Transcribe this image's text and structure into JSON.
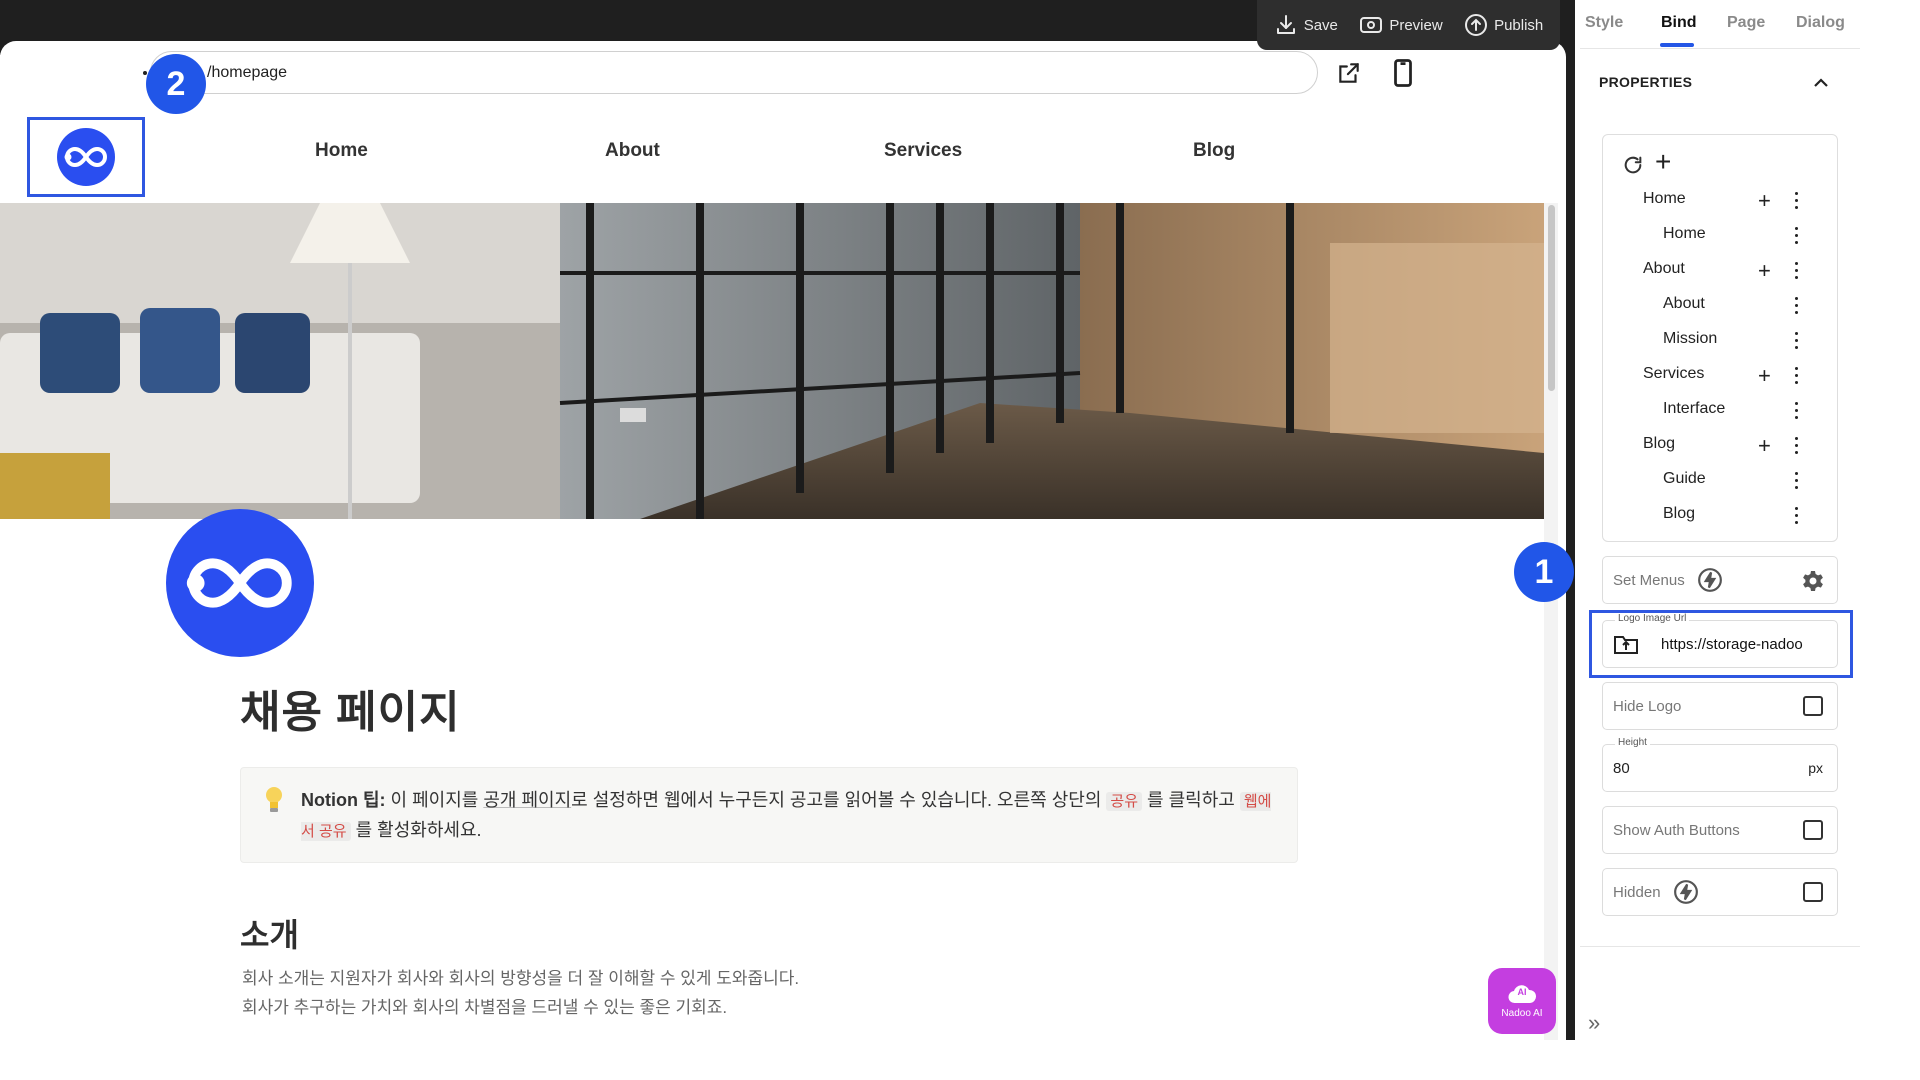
{
  "toolbar": {
    "save_label": "Save",
    "preview_label": "Preview",
    "publish_label": "Publish"
  },
  "url_bar": {
    "value": "/homepage"
  },
  "badges": {
    "one": "1",
    "two": "2"
  },
  "site_nav": {
    "items": [
      "Home",
      "About",
      "Services",
      "Blog"
    ]
  },
  "content": {
    "page_title": "채용 페이지",
    "callout": {
      "bold_prefix": "Notion 팁:",
      "part1": " 이 페이지를 ",
      "link": "공개 페이지",
      "part2": "로 설정하면 웹에서 누구든지 공고를 읽어볼 수 있습니다. 오른쪽 상단의 ",
      "code1": "공유",
      "part3": " 를 클릭하고 ",
      "code2": "웹에서 공유",
      "part4": " 를 활성화하세요."
    },
    "section_title": "소개",
    "paragraphs": [
      "회사 소개는 지원자가 회사와 회사의 방향성을 더 잘 이해할 수 있게 도와줍니다.",
      "회사가 추구하는 가치와 회사의 차별점을 드러낼 수 있는 좋은 기회죠."
    ]
  },
  "ai_button": {
    "label": "Nadoo AI",
    "icon_text": "AI"
  },
  "panel": {
    "tabs": [
      "Style",
      "Bind",
      "Page",
      "Dialog"
    ],
    "active_tab": "Bind",
    "properties_title": "PROPERTIES",
    "menu_tree": [
      {
        "label": "Home",
        "level": 0
      },
      {
        "label": "Home",
        "level": 1
      },
      {
        "label": "About",
        "level": 0
      },
      {
        "label": "About",
        "level": 1
      },
      {
        "label": "Mission",
        "level": 1
      },
      {
        "label": "Services",
        "level": 0
      },
      {
        "label": "Interface",
        "level": 1
      },
      {
        "label": "Blog",
        "level": 0
      },
      {
        "label": "Guide",
        "level": 1
      },
      {
        "label": "Blog",
        "level": 1
      }
    ],
    "set_menus_label": "Set Menus",
    "logo_url": {
      "label": "Logo Image Url",
      "value": "https://storage-nadoo"
    },
    "hide_logo_label": "Hide Logo",
    "height": {
      "label": "Height",
      "value": "80",
      "unit": "px"
    },
    "show_auth_label": "Show Auth Buttons",
    "hidden_label": "Hidden"
  },
  "colors": {
    "accent": "#2456e6",
    "logo_blue": "#2a4ef0",
    "ai_purple": "#c43ee0",
    "dark_bar": "#1f1f1f"
  }
}
